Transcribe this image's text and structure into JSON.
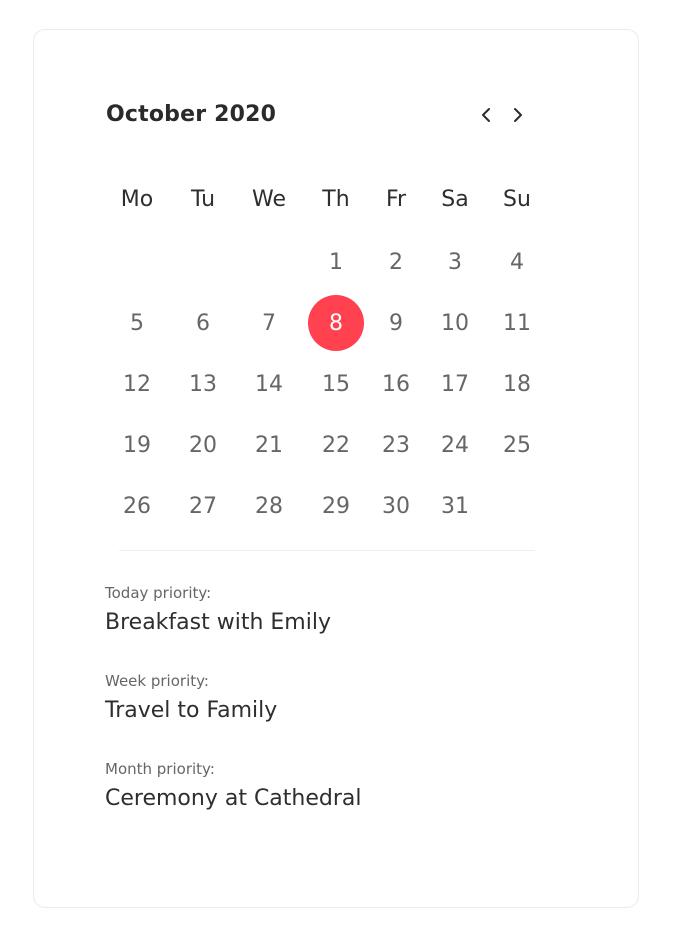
{
  "calendar": {
    "month_label": "October 2020",
    "weekdays": [
      "Mo",
      "Tu",
      "We",
      "Th",
      "Fr",
      "Sa",
      "Su"
    ],
    "first_weekday_index": 3,
    "days_in_month": 31,
    "selected_day": "8",
    "selected_color": "#ff4150",
    "days": [
      "1",
      "2",
      "3",
      "4",
      "5",
      "6",
      "7",
      "8",
      "9",
      "10",
      "11",
      "12",
      "13",
      "14",
      "15",
      "16",
      "17",
      "18",
      "19",
      "20",
      "21",
      "22",
      "23",
      "24",
      "25",
      "26",
      "27",
      "28",
      "29",
      "30",
      "31"
    ]
  },
  "nav": {
    "prev_icon": "chevron-left-icon",
    "next_icon": "chevron-right-icon"
  },
  "priorities": [
    {
      "label": "Today priority:",
      "value": "Breakfast with Emily"
    },
    {
      "label": "Week priority:",
      "value": "Travel to Family"
    },
    {
      "label": "Month priority:",
      "value": "Ceremony at Cathedral"
    }
  ]
}
